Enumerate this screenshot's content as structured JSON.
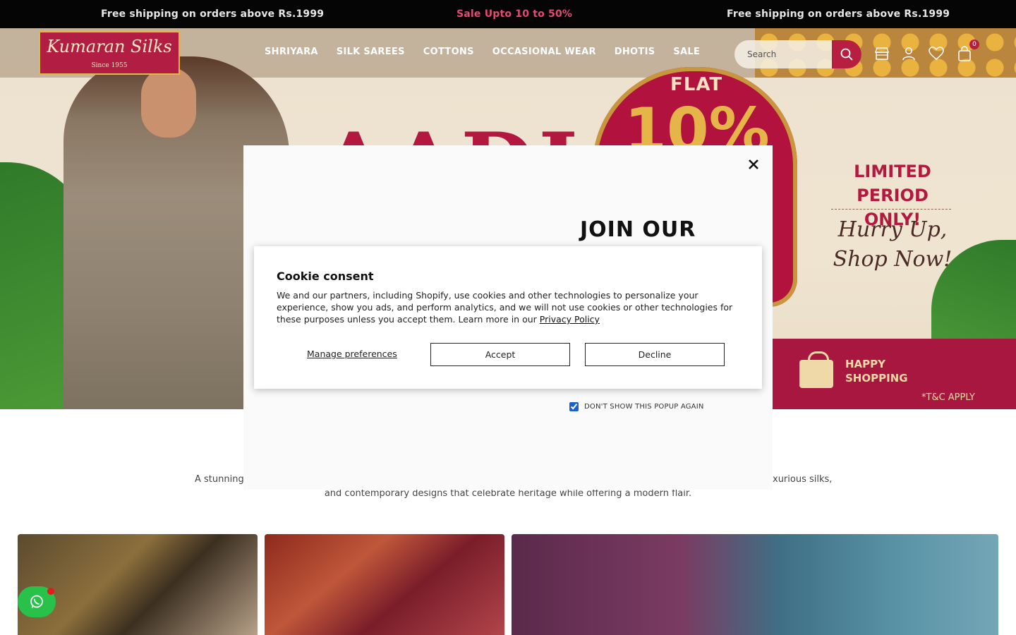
{
  "announcement": {
    "left": "Free shipping on orders above Rs.1999",
    "center": "Sale Upto 10 to 50%",
    "right": "Free shipping on orders above Rs.1999"
  },
  "logo": {
    "name": "Kumaran Silks",
    "since": "Since 1955"
  },
  "nav": {
    "items": [
      "SHRIYARA",
      "SILK SAREES",
      "COTTONS",
      "OCCASIONAL WEAR",
      "DHOTIS",
      "SALE"
    ]
  },
  "search": {
    "placeholder": "Search"
  },
  "cart": {
    "count": "0"
  },
  "hero": {
    "title_partial": "AADI",
    "flat": "FLAT",
    "percent": "10%",
    "limited": "LIMITED PERIOD ONLY!",
    "hurry": "Hurry Up, Shop Now!",
    "happy": "HAPPY SHOPPING",
    "tc": "*T&C APPLY"
  },
  "section": {
    "description_left": "A stunning c",
    "description_right": "xurious silks,",
    "description_line2": "and contemporary designs that celebrate heritage while offering a modern flair."
  },
  "newsletter": {
    "title": "JOIN OUR",
    "dont_show": "DON'T SHOW THIS POPUP AGAIN",
    "dont_show_checked": true
  },
  "cookie": {
    "title": "Cookie consent",
    "body": "We and our partners, including Shopify, use cookies and other technologies to personalize your experience, show you ads, and perform analytics, and we will not use cookies or other technologies for these purposes unless you accept them. Learn more in our ",
    "privacy_link": "Privacy Policy",
    "manage": "Manage preferences",
    "accept": "Accept",
    "decline": "Decline"
  },
  "colors": {
    "brand": "#b81e3f",
    "sale_text": "#e44a73",
    "whatsapp": "#28c24b"
  }
}
